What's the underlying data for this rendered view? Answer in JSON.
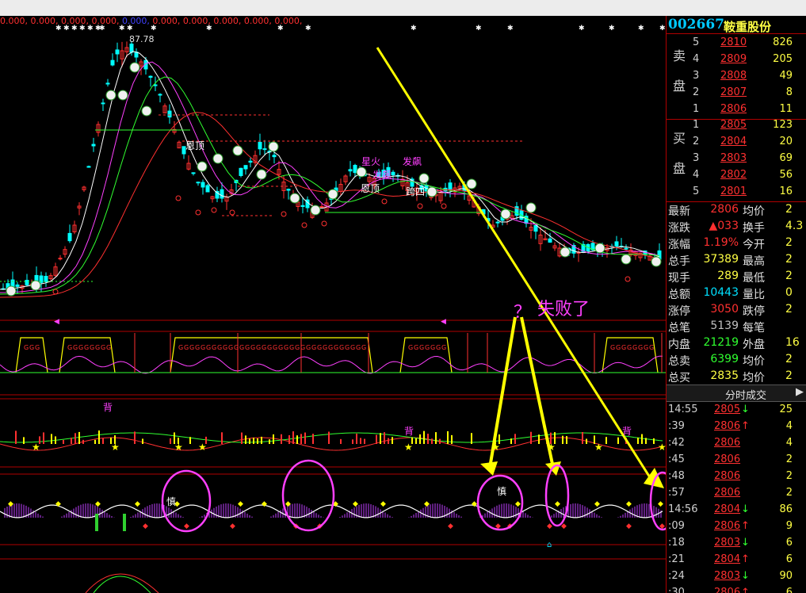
{
  "stock": {
    "code": "002667",
    "name": "鞍重股份"
  },
  "ma_values_line": [
    "0.000,",
    "0.000,",
    "0.000,",
    "0.000,",
    "0.000,",
    "0.000,",
    "0.000,",
    "0.000,",
    "0.000,",
    "0.000,"
  ],
  "high_label": "87.78",
  "annotation": {
    "question": "？",
    "failed_text": "失败了"
  },
  "orderbook": {
    "ask_side_label": [
      "卖",
      "盘"
    ],
    "bid_side_label": [
      "买",
      "盘"
    ],
    "asks": [
      {
        "level": "5",
        "price": "2810",
        "vol": "826"
      },
      {
        "level": "4",
        "price": "2809",
        "vol": "205"
      },
      {
        "level": "3",
        "price": "2808",
        "vol": "49"
      },
      {
        "level": "2",
        "price": "2807",
        "vol": "8"
      },
      {
        "level": "1",
        "price": "2806",
        "vol": "11"
      }
    ],
    "bids": [
      {
        "level": "1",
        "price": "2805",
        "vol": "123"
      },
      {
        "level": "2",
        "price": "2804",
        "vol": "20"
      },
      {
        "level": "3",
        "price": "2803",
        "vol": "69"
      },
      {
        "level": "4",
        "price": "2802",
        "vol": "56"
      },
      {
        "level": "5",
        "price": "2801",
        "vol": "16"
      }
    ]
  },
  "stats": [
    {
      "k1": "最新",
      "v1": "2806",
      "c1": "red",
      "k2": "均价",
      "v2": "2"
    },
    {
      "k1": "涨跌",
      "v1": "▲033",
      "c1": "red",
      "k2": "换手",
      "v2": "4.3"
    },
    {
      "k1": "涨幅",
      "v1": "1.19%",
      "c1": "red",
      "k2": "今开",
      "v2": "2"
    },
    {
      "k1": "总手",
      "v1": "37389",
      "c1": "yel",
      "k2": "最高",
      "v2": "2"
    },
    {
      "k1": "现手",
      "v1": "289",
      "c1": "yel",
      "k2": "最低",
      "v2": "2"
    },
    {
      "k1": "总额",
      "v1": "10443",
      "c1": "cyan",
      "k2": "量比",
      "v2": "0"
    },
    {
      "k1": "涨停",
      "v1": "3050",
      "c1": "red",
      "k2": "跌停",
      "v2": "2"
    },
    {
      "k1": "总笔",
      "v1": "5139",
      "c1": "wht",
      "k2": "每笔",
      "v2": ""
    },
    {
      "k1": "内盘",
      "v1": "21219",
      "c1": "grn",
      "k2": "外盘",
      "v2": "16"
    },
    {
      "k1": "总卖",
      "v1": "6399",
      "c1": "grn",
      "k2": "均价",
      "v2": "2"
    },
    {
      "k1": "总买",
      "v1": "2835",
      "c1": "yel",
      "k2": "均价",
      "v2": "2"
    }
  ],
  "tick_tab": {
    "label": "分时成交",
    "arrow": "▶"
  },
  "ticks": [
    {
      "time": "14:55",
      "price": "2805",
      "dir": "↓",
      "vol": "25"
    },
    {
      "time": ":39",
      "price": "2806",
      "dir": "↑",
      "vol": "4"
    },
    {
      "time": ":42",
      "price": "2806",
      "dir": "",
      "vol": "4"
    },
    {
      "time": ":45",
      "price": "2806",
      "dir": "",
      "vol": "2"
    },
    {
      "time": ":48",
      "price": "2806",
      "dir": "",
      "vol": "2"
    },
    {
      "time": ":57",
      "price": "2806",
      "dir": "",
      "vol": "2"
    },
    {
      "time": "14:56",
      "price": "2804",
      "dir": "↓",
      "vol": "86"
    },
    {
      "time": ":09",
      "price": "2806",
      "dir": "↑",
      "vol": "9"
    },
    {
      "time": ":18",
      "price": "2803",
      "dir": "↓",
      "vol": "6"
    },
    {
      "time": ":21",
      "price": "2804",
      "dir": "↑",
      "vol": "6"
    },
    {
      "time": ":24",
      "price": "2803",
      "dir": "↓",
      "vol": "90"
    },
    {
      "time": ":30",
      "price": "2806",
      "dir": "↑",
      "vol": "6"
    }
  ],
  "chart_labels": [
    "星火",
    "发飙",
    "发飙",
    "恩顶",
    "恩顶",
    "跨四",
    "慎",
    "慎",
    "背",
    "背",
    "背"
  ],
  "colors": {
    "up": "#ff3030",
    "down": "#00ffff",
    "ma1": "#ffffff",
    "ma2": "#ff40ff",
    "ma3": "#30ff30",
    "ma4": "#ff3030",
    "arrow": "#ffff00",
    "circle": "#ff40ff"
  }
}
